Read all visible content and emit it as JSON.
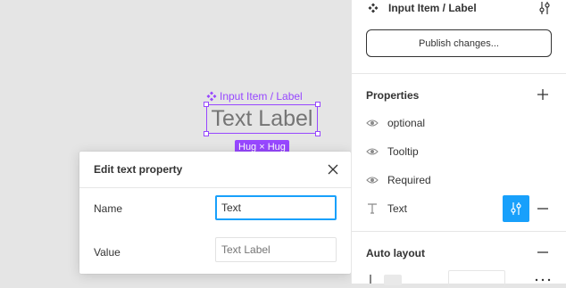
{
  "canvas": {
    "component_tag": "Input Item / Label",
    "text_label": "Text Label",
    "hug_badge": "Hug × Hug"
  },
  "popover": {
    "title": "Edit text property",
    "name_label": "Name",
    "name_value": "Text",
    "value_label": "Value",
    "value_placeholder": "Text Label"
  },
  "panel": {
    "component_name": "Input Item / Label",
    "publish_label": "Publish changes...",
    "properties_title": "Properties",
    "properties": [
      {
        "label": "optional",
        "icon": "eye-icon"
      },
      {
        "label": "Tooltip",
        "icon": "eye-icon"
      },
      {
        "label": "Required",
        "icon": "eye-icon"
      },
      {
        "label": "Text",
        "icon": "text-icon"
      }
    ],
    "auto_layout_title": "Auto layout"
  },
  "colors": {
    "component_purple": "#9747ff",
    "accent_blue": "#18a0fb"
  }
}
